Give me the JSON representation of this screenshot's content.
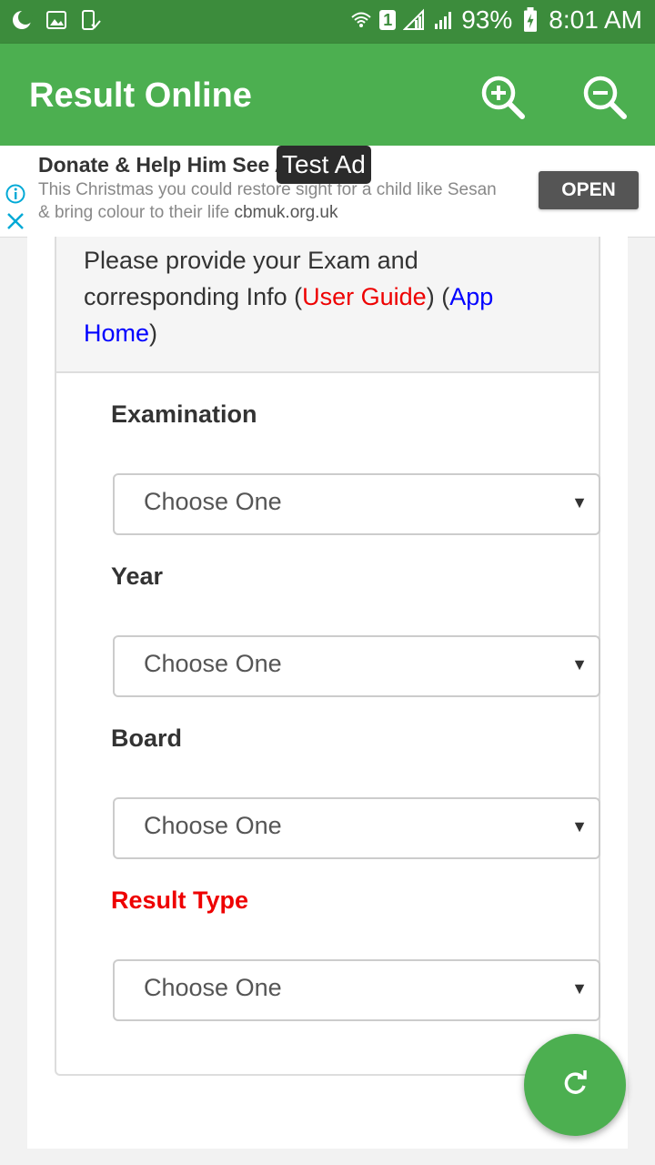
{
  "status_bar": {
    "sim": "1",
    "battery": "93%",
    "time": "8:01 AM"
  },
  "app_bar": {
    "title": "Result Online",
    "zoom_in_icon": "zoom-in-icon",
    "zoom_out_icon": "zoom-out-icon"
  },
  "ad": {
    "title": "Donate & Help Him See A",
    "label": "Test Ad",
    "line1": "This Christmas you could restore sight for a child like Sesan",
    "line2": "& bring colour to their life",
    "domain": "cbmuk.org.uk",
    "open_label": "OPEN"
  },
  "form": {
    "intro": "Please provide your Exam and corresponding Info (",
    "user_guide": "User Guide",
    "mid": ") (",
    "app_home": "App Home",
    "end": ")",
    "fields": [
      {
        "label": "Examination",
        "value": "Choose One"
      },
      {
        "label": "Year",
        "value": "Choose One"
      },
      {
        "label": "Board",
        "value": "Choose One"
      },
      {
        "label": "Result Type",
        "value": "Choose One"
      }
    ]
  },
  "colors": {
    "primary": "#4caf50",
    "status_bar": "#3c8c3c",
    "link_red": "#ee0000",
    "link_blue": "#0000ff"
  }
}
